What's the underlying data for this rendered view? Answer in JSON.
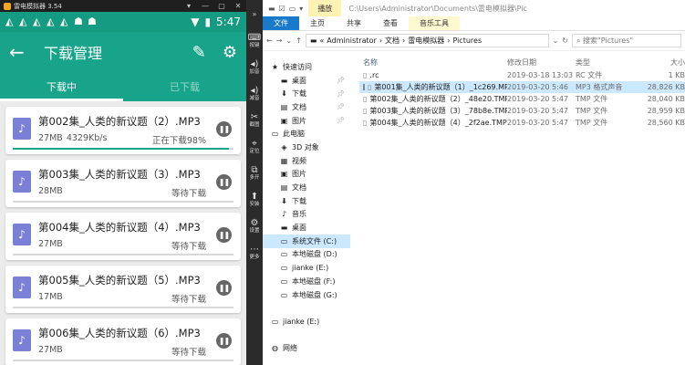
{
  "emulator": {
    "title": "雷电模拟器 3.54",
    "controls": [
      "▾",
      "—",
      "▢",
      "✕"
    ],
    "statusbar": {
      "time": "5:47"
    },
    "appbar": {
      "back": "←",
      "title": "下载管理",
      "edit": "✎",
      "settings": "⚙"
    },
    "tabs": [
      "下载中",
      "已下载"
    ],
    "downloads": [
      {
        "name": "第002集_人类的新议题（2）.MP3",
        "size": "27MB",
        "speed": "4329Kb/s",
        "status": "正在下载98%",
        "progress": 0.98
      },
      {
        "name": "第003集_人类的新议题（3）.MP3",
        "size": "28MB",
        "speed": "",
        "status": "等待下载",
        "progress": 0
      },
      {
        "name": "第004集_人类的新议题（4）.MP3",
        "size": "27MB",
        "speed": "",
        "status": "等待下载",
        "progress": 0
      },
      {
        "name": "第005集_人类的新议题（5）.MP3",
        "size": "17MB",
        "speed": "",
        "status": "等待下载",
        "progress": 0
      },
      {
        "name": "第006集_人类的新议题（6）.MP3",
        "size": "27MB",
        "speed": "",
        "status": "等待下载",
        "progress": 0
      }
    ],
    "sidebar": [
      {
        "icon": "⌨",
        "label": "按键"
      },
      {
        "icon": "◂)",
        "label": "加音"
      },
      {
        "icon": "◂)",
        "label": "减音"
      },
      {
        "icon": "✂",
        "label": "截图"
      },
      {
        "icon": "⌖",
        "label": "定位"
      },
      {
        "icon": "⧉",
        "label": "多开"
      },
      {
        "icon": "⬆",
        "label": "安装"
      },
      {
        "icon": "⚙",
        "label": "设置"
      },
      {
        "icon": "⋯",
        "label": "更多"
      }
    ]
  },
  "explorer": {
    "context_tab": "播放",
    "path_title": "C:\\Users\\Administrator\\Documents\\雷电模拟器\\Pic",
    "ribbon": [
      "文件",
      "主页",
      "共享",
      "查看",
      "音乐工具"
    ],
    "breadcrumb": [
      "Administrator",
      "文档",
      "雷电模拟器",
      "Pictures"
    ],
    "search_placeholder": "搜索\"Pictures\"",
    "nav": [
      {
        "label": "快速访问",
        "icon": "★",
        "pin": false,
        "indent": 0
      },
      {
        "label": "桌面",
        "icon": "▬",
        "pin": true,
        "indent": 1
      },
      {
        "label": "下载",
        "icon": "⬇",
        "pin": true,
        "indent": 1
      },
      {
        "label": "文档",
        "icon": "▤",
        "pin": true,
        "indent": 1
      },
      {
        "label": "图片",
        "icon": "▣",
        "pin": true,
        "indent": 1
      },
      {
        "label": "此电脑",
        "icon": "▭",
        "pin": false,
        "indent": 0
      },
      {
        "label": "3D 对象",
        "icon": "◈",
        "pin": false,
        "indent": 1
      },
      {
        "label": "视频",
        "icon": "▦",
        "pin": false,
        "indent": 1
      },
      {
        "label": "图片",
        "icon": "▣",
        "pin": false,
        "indent": 1
      },
      {
        "label": "文档",
        "icon": "▤",
        "pin": false,
        "indent": 1
      },
      {
        "label": "下载",
        "icon": "⬇",
        "pin": false,
        "indent": 1
      },
      {
        "label": "音乐",
        "icon": "♪",
        "pin": false,
        "indent": 1
      },
      {
        "label": "桌面",
        "icon": "▬",
        "pin": false,
        "indent": 1
      },
      {
        "label": "系统文件 (C:)",
        "icon": "▭",
        "pin": false,
        "indent": 1,
        "selected": true
      },
      {
        "label": "本地磁盘 (D:)",
        "icon": "▭",
        "pin": false,
        "indent": 1
      },
      {
        "label": "jianke (E:)",
        "icon": "▭",
        "pin": false,
        "indent": 1
      },
      {
        "label": "本地磁盘 (F:)",
        "icon": "▭",
        "pin": false,
        "indent": 1
      },
      {
        "label": "本地磁盘 (G:)",
        "icon": "▭",
        "pin": false,
        "indent": 1
      },
      {
        "label": "",
        "icon": "",
        "pin": false,
        "indent": 0
      },
      {
        "label": "jianke (E:)",
        "icon": "▭",
        "pin": false,
        "indent": 0
      },
      {
        "label": "",
        "icon": "",
        "pin": false,
        "indent": 0
      },
      {
        "label": "网络",
        "icon": "◍",
        "pin": false,
        "indent": 0
      }
    ],
    "columns": [
      "名称",
      "修改日期",
      "类型",
      "大小"
    ],
    "files": [
      {
        "name": ".rc",
        "date": "2019-03-18 13:03",
        "type": "RC 文件",
        "size": "1 KB",
        "selected": false
      },
      {
        "name": "第001集_人类的新议题（1）_1c269.MP3",
        "date": "2019-03-20 5:46",
        "type": "MP3 格式声音",
        "size": "28,826 KB",
        "selected": true
      },
      {
        "name": "第002集_人类的新议题（2）_48e20.TMP",
        "date": "2019-03-20 5:47",
        "type": "TMP 文件",
        "size": "28,040 KB",
        "selected": false
      },
      {
        "name": "第003集_人类的新议题（3）_78b8e.TMP",
        "date": "2019-03-20 5:47",
        "type": "TMP 文件",
        "size": "28,959 KB",
        "selected": false
      },
      {
        "name": "第004集_人类的新议题（4）_2f2ae.TMP",
        "date": "2019-03-20 5:47",
        "type": "TMP 文件",
        "size": "28,560 KB",
        "selected": false
      }
    ]
  }
}
